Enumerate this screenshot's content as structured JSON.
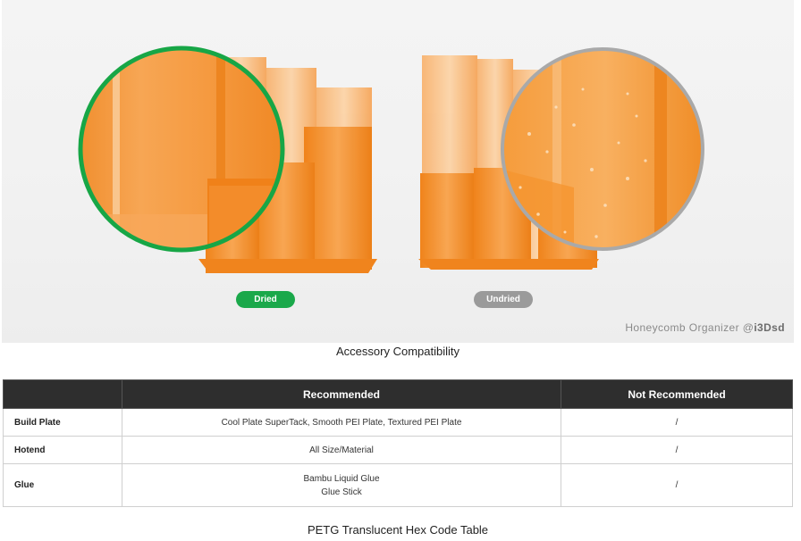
{
  "hero": {
    "label_dried": "Dried",
    "label_undried": "Undried",
    "credit_prefix": "Honeycomb Organizer @",
    "credit_handle": "i3Dsd",
    "colors": {
      "dried": "#1aa84a",
      "undried": "#9a9a9a",
      "filament": "#f58a1f"
    }
  },
  "section1_title": "Accessory Compatibility",
  "table": {
    "headers": [
      "",
      "Recommended",
      "Not Recommended"
    ],
    "rows": [
      {
        "label": "Build Plate",
        "recommended": [
          "Cool Plate SuperTack, Smooth PEI Plate, Textured PEI Plate"
        ],
        "not_recommended": "/"
      },
      {
        "label": "Hotend",
        "recommended": [
          "All Size/Material"
        ],
        "not_recommended": "/"
      },
      {
        "label": "Glue",
        "recommended": [
          "Bambu Liquid Glue",
          "Glue Stick"
        ],
        "not_recommended": "/"
      }
    ]
  },
  "section2_title": "PETG Translucent Hex Code Table"
}
